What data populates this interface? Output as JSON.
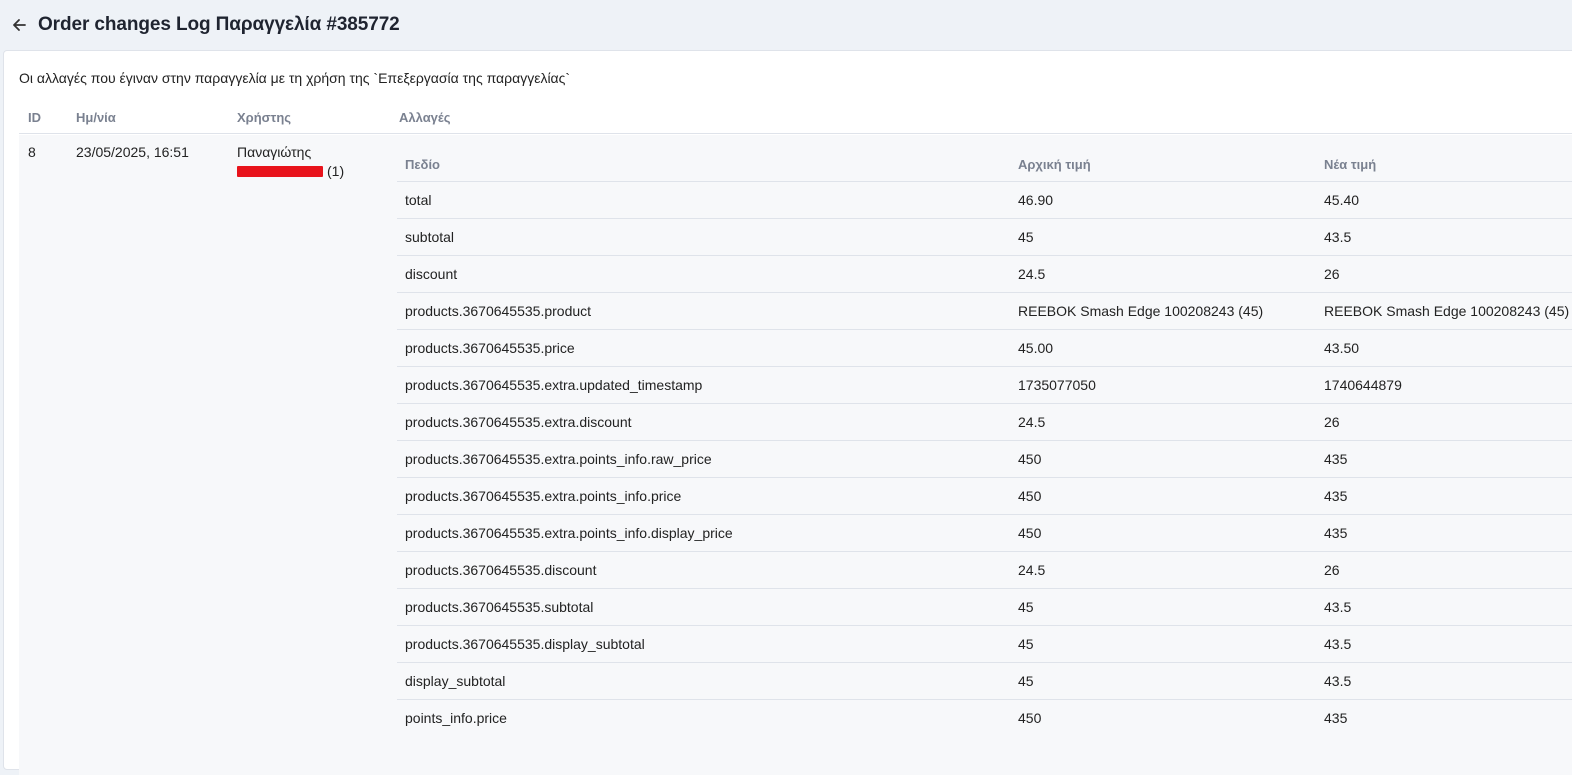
{
  "header": {
    "title": "Order changes Log Παραγγελία #385772"
  },
  "intro_text": "Οι αλλαγές που έγιναν στην παραγγελία με τη χρήση της `Επεξεργασία της παραγγελίας`",
  "table": {
    "columns": [
      "ID",
      "Ημ/νία",
      "Χρήστης",
      "Αλλαγές"
    ],
    "row": {
      "id": "8",
      "date": "23/05/2025, 16:51",
      "user_name": "Παναγιώτης",
      "user_suffix": "(1)"
    }
  },
  "changes": {
    "columns": [
      "Πεδίο",
      "Αρχική τιμή",
      "Νέα τιμή"
    ],
    "rows": [
      {
        "field": "total",
        "old": "46.90",
        "new": "45.40"
      },
      {
        "field": "subtotal",
        "old": "45",
        "new": "43.5"
      },
      {
        "field": "discount",
        "old": "24.5",
        "new": "26"
      },
      {
        "field": "products.3670645535.product",
        "old": "REEBOK Smash Edge 100208243 (45)",
        "new": "REEBOK Smash Edge 100208243 (45)"
      },
      {
        "field": "products.3670645535.price",
        "old": "45.00",
        "new": "43.50"
      },
      {
        "field": "products.3670645535.extra.updated_timestamp",
        "old": "1735077050",
        "new": "1740644879"
      },
      {
        "field": "products.3670645535.extra.discount",
        "old": "24.5",
        "new": "26"
      },
      {
        "field": "products.3670645535.extra.points_info.raw_price",
        "old": "450",
        "new": "435"
      },
      {
        "field": "products.3670645535.extra.points_info.price",
        "old": "450",
        "new": "435"
      },
      {
        "field": "products.3670645535.extra.points_info.display_price",
        "old": "450",
        "new": "435"
      },
      {
        "field": "products.3670645535.discount",
        "old": "24.5",
        "new": "26"
      },
      {
        "field": "products.3670645535.subtotal",
        "old": "45",
        "new": "43.5"
      },
      {
        "field": "products.3670645535.display_subtotal",
        "old": "45",
        "new": "43.5"
      },
      {
        "field": "display_subtotal",
        "old": "45",
        "new": "43.5"
      },
      {
        "field": "points_info.price",
        "old": "450",
        "new": "435"
      }
    ]
  }
}
